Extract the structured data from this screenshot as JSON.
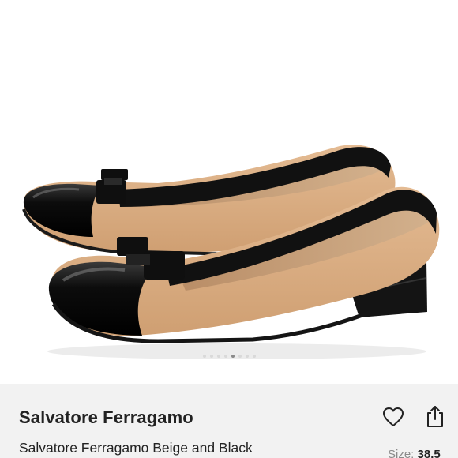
{
  "listing": {
    "brand": "Salvatore Ferragamo",
    "title": "Salvatore Ferragamo Beige and Black",
    "size_label": "Size:",
    "size_value": "38.5"
  },
  "carousel": {
    "dot_count": 8,
    "active_index": 4
  },
  "icons": {
    "like": "heart-icon",
    "share": "share-icon"
  },
  "colors": {
    "panel_bg": "#f2f2f2",
    "text_primary": "#222222",
    "text_secondary": "#8a8a8a",
    "shoe_beige": "#d9ad84",
    "shoe_black": "#111111"
  }
}
